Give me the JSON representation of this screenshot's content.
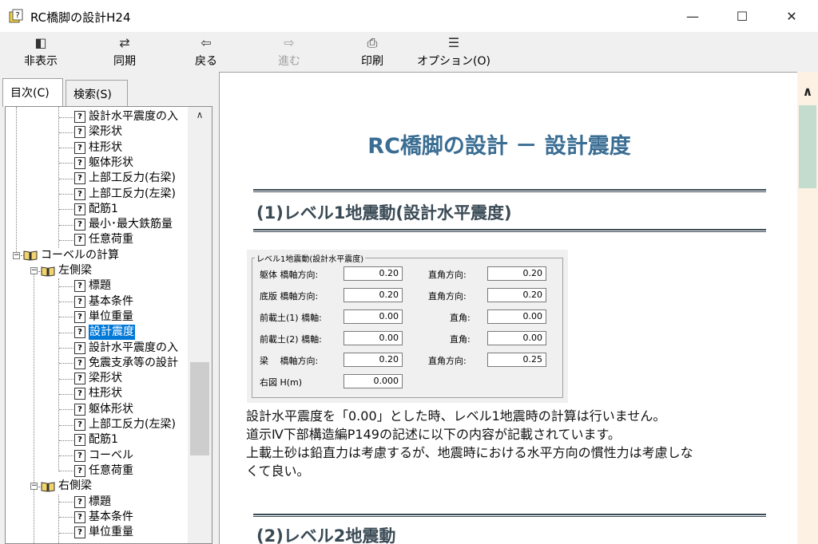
{
  "window": {
    "title": "RC橋脚の設計H24",
    "min_glyph": "—",
    "max_glyph": "☐",
    "close_glyph": "✕"
  },
  "toolbar": [
    {
      "label": "非表示",
      "icon": "hide-pane-icon",
      "glyph": "◧"
    },
    {
      "label": "同期",
      "icon": "sync-icon",
      "glyph": "⇄"
    },
    {
      "label": "戻る",
      "icon": "back-arrow-icon",
      "glyph": "⇦"
    },
    {
      "label": "進む",
      "icon": "forward-arrow-icon",
      "glyph": "⇨"
    },
    {
      "label": "印刷",
      "icon": "printer-icon",
      "glyph": "⎙"
    },
    {
      "label": "オプション(O)",
      "icon": "options-icon",
      "glyph": "☰"
    }
  ],
  "tabs": {
    "contents": "目次(C)",
    "search": "検索(S)"
  },
  "tree": [
    {
      "label": "設計水平震度の入",
      "type": "topic"
    },
    {
      "label": "梁形状",
      "type": "topic"
    },
    {
      "label": "柱形状",
      "type": "topic"
    },
    {
      "label": "躯体形状",
      "type": "topic"
    },
    {
      "label": "上部工反力(右梁)",
      "type": "topic"
    },
    {
      "label": "上部工反力(左梁)",
      "type": "topic"
    },
    {
      "label": "配筋1",
      "type": "topic"
    },
    {
      "label": "最小･最大鉄筋量",
      "type": "topic"
    },
    {
      "label": "任意荷重",
      "type": "topic"
    },
    {
      "label": "コーベルの計算",
      "type": "book"
    },
    {
      "label": "左側梁",
      "type": "book"
    },
    {
      "label": "標題",
      "type": "topic"
    },
    {
      "label": "基本条件",
      "type": "topic"
    },
    {
      "label": "単位重量",
      "type": "topic"
    },
    {
      "label": "設計震度",
      "type": "topic",
      "selected": true
    },
    {
      "label": "設計水平震度の入",
      "type": "topic"
    },
    {
      "label": "免震支承等の設計",
      "type": "topic"
    },
    {
      "label": "梁形状",
      "type": "topic"
    },
    {
      "label": "柱形状",
      "type": "topic"
    },
    {
      "label": "躯体形状",
      "type": "topic"
    },
    {
      "label": "上部工反力(左梁)",
      "type": "topic"
    },
    {
      "label": "配筋1",
      "type": "topic"
    },
    {
      "label": "コーベル",
      "type": "topic"
    },
    {
      "label": "任意荷重",
      "type": "topic"
    },
    {
      "label": "右側梁",
      "type": "book"
    },
    {
      "label": "標題",
      "type": "topic"
    },
    {
      "label": "基本条件",
      "type": "topic"
    },
    {
      "label": "単位重量",
      "type": "topic"
    }
  ],
  "expander": {
    "minus": "−"
  },
  "topic_glyph": "?",
  "scroll_up_glyph": "∧",
  "content": {
    "title": "RC橋脚の設計 － 設計震度",
    "section1": "(1)レベル1地震動(設計水平震度)",
    "section2": "(2)レベル2地震動",
    "panel": {
      "caption": "レベル1地震動(設計水平震度)",
      "rows": [
        {
          "label": "躯体 橋軸方向:",
          "value": "0.20",
          "label2": "直角方向:",
          "value2": "0.20"
        },
        {
          "label": "底版 橋軸方向:",
          "value": "0.20",
          "label2": "直角方向:",
          "value2": "0.20"
        },
        {
          "label": "前載土(1) 橋軸:",
          "value": "0.00",
          "label2": "直角:",
          "value2": "0.00"
        },
        {
          "label": "前載土(2) 橋軸:",
          "value": "0.00",
          "label2": "直角:",
          "value2": "0.00"
        },
        {
          "label": "梁　 橋軸方向:",
          "value": "0.20",
          "label2": "直角方向:",
          "value2": "0.25"
        },
        {
          "label": "右図 H(m)",
          "value": "0.000"
        }
      ]
    },
    "paragraphs": [
      "設計水平震度を「0.00」とした時、レベル1地震時の計算は行いません。",
      "道示Ⅳ下部構造編P149の記述に以下の内容が記載されています。",
      "上載土砂は鉛直力は考慮するが、地震時における水平方向の慣性力は考慮しな",
      "くて良い。"
    ]
  },
  "colors": {
    "title_blue": "#3a6d93",
    "selection": "#0078d7",
    "scroll_track": "#fdf1e3",
    "scroll_thumb": "#c4dccd"
  }
}
